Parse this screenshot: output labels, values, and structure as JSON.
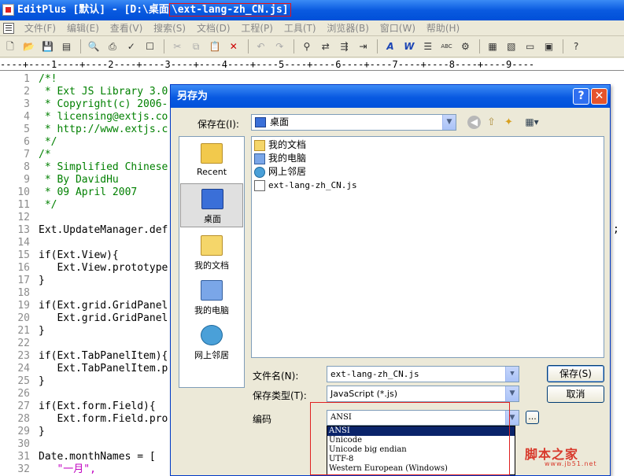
{
  "window": {
    "title_prefix": "EditPlus [默认] - [D:\\桌面",
    "title_file": "\\ext-lang-zh_CN.js]"
  },
  "menu": [
    "文件(F)",
    "编辑(E)",
    "查看(V)",
    "搜索(S)",
    "文档(D)",
    "工程(P)",
    "工具(T)",
    "浏览器(B)",
    "窗口(W)",
    "帮助(H)"
  ],
  "toolbar_glyphs": [
    "A",
    "W",
    "ABC"
  ],
  "ruler": "----+----1----+----2----+----3----+----4----+----5----+----6----+----7----+----8----+----9----",
  "editor": {
    "lines": [
      {
        "n": "1",
        "text": "/*!",
        "cls": "cm"
      },
      {
        "n": "2",
        "text": " * Ext JS Library 3.0",
        "cls": "cm"
      },
      {
        "n": "3",
        "text": " * Copyright(c) 2006-",
        "cls": "cm"
      },
      {
        "n": "4",
        "text": " * licensing@extjs.co",
        "cls": "cm"
      },
      {
        "n": "5",
        "text": " * http://www.extjs.c",
        "cls": "cm"
      },
      {
        "n": "6",
        "text": " */",
        "cls": "cm"
      },
      {
        "n": "7",
        "text": "/*",
        "cls": "cm"
      },
      {
        "n": "8",
        "text": " * Simplified Chinese",
        "cls": "cm"
      },
      {
        "n": "9",
        "text": " * By DavidHu",
        "cls": "cm"
      },
      {
        "n": "10",
        "text": " * 09 April 2007",
        "cls": "cm"
      },
      {
        "n": "11",
        "text": " */",
        "cls": "cm"
      },
      {
        "n": "12",
        "text": "",
        "cls": ""
      },
      {
        "n": "13",
        "text": "Ext.UpdateManager.def",
        "cls": ""
      },
      {
        "n": "14",
        "text": "",
        "cls": ""
      },
      {
        "n": "15",
        "text": "if(Ext.View){",
        "cls": ""
      },
      {
        "n": "16",
        "text": "   Ext.View.prototype",
        "cls": ""
      },
      {
        "n": "17",
        "text": "}",
        "cls": ""
      },
      {
        "n": "18",
        "text": "",
        "cls": ""
      },
      {
        "n": "19",
        "text": "if(Ext.grid.GridPanel",
        "cls": ""
      },
      {
        "n": "20",
        "text": "   Ext.grid.GridPanel",
        "cls": ""
      },
      {
        "n": "21",
        "text": "}",
        "cls": ""
      },
      {
        "n": "22",
        "text": "",
        "cls": ""
      },
      {
        "n": "23",
        "text": "if(Ext.TabPanelItem){",
        "cls": ""
      },
      {
        "n": "24",
        "text": "   Ext.TabPanelItem.p",
        "cls": ""
      },
      {
        "n": "25",
        "text": "}",
        "cls": ""
      },
      {
        "n": "26",
        "text": "",
        "cls": ""
      },
      {
        "n": "27",
        "text": "if(Ext.form.Field){",
        "cls": ""
      },
      {
        "n": "28",
        "text": "   Ext.form.Field.pro",
        "cls": ""
      },
      {
        "n": "29",
        "text": "}",
        "cls": ""
      },
      {
        "n": "30",
        "text": "",
        "cls": ""
      },
      {
        "n": "31",
        "text": "Date.monthNames = [",
        "cls": ""
      },
      {
        "n": "32",
        "text": "   \"一月\",",
        "cls": "str"
      }
    ],
    "right_edge_char": ";"
  },
  "dialog": {
    "title": "另存为",
    "save_in_label": "保存在(I):",
    "save_in_value": "桌面",
    "places": [
      "Recent",
      "桌面",
      "我的文档",
      "我的电脑",
      "网上邻居"
    ],
    "files": [
      "我的文档",
      "我的电脑",
      "网上邻居",
      "ext-lang-zh_CN.js"
    ],
    "filename_label": "文件名(N):",
    "filename_value": "ext-lang-zh_CN.js",
    "filetype_label": "保存类型(T):",
    "filetype_value": "JavaScript (*.js)",
    "encoding_label": "编码",
    "encoding_value": "ANSI",
    "encoding_options": [
      "ANSI",
      "Unicode",
      "Unicode big endian",
      "UTF-8",
      "Western European (Windows)"
    ],
    "encoding_selected": 0,
    "save_button": "保存(S)",
    "cancel_button": "取消",
    "browse_button": "..."
  },
  "watermark": {
    "text": "脚本之家",
    "url": "www.jb51.net"
  },
  "colors": {
    "titlebar": "#0a5ae0",
    "highlight_box": "#e02020",
    "selection": "#0a246a",
    "comment": "#008000"
  }
}
